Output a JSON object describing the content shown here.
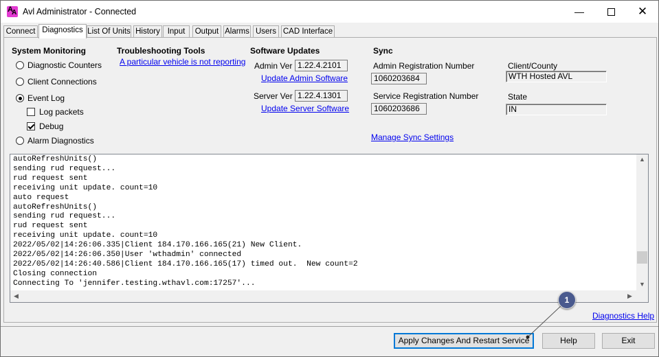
{
  "window": {
    "title": "Avl Administrator - Connected",
    "minimize_glyph": "—",
    "close_glyph": "✕"
  },
  "tabs": [
    {
      "label": "Connect"
    },
    {
      "label": "Diagnostics"
    },
    {
      "label": "List Of Units"
    },
    {
      "label": "History"
    },
    {
      "label": "Input"
    },
    {
      "label": "Output"
    },
    {
      "label": "Alarms"
    },
    {
      "label": "Users"
    },
    {
      "label": "CAD Interface"
    }
  ],
  "system_monitoring": {
    "header": "System Monitoring",
    "options": [
      {
        "label": "Diagnostic Counters",
        "selected": false
      },
      {
        "label": "Client Connections",
        "selected": false
      },
      {
        "label": "Event Log",
        "selected": true
      },
      {
        "label": "Alarm Diagnostics",
        "selected": false
      }
    ],
    "log_packets": {
      "label": "Log packets",
      "checked": false
    },
    "debug": {
      "label": "Debug",
      "checked": true
    }
  },
  "troubleshooting": {
    "header": "Troubleshooting Tools",
    "link": "A particular vehicle is not reporting"
  },
  "software_updates": {
    "header": "Software Updates",
    "admin_ver_label": "Admin Ver",
    "admin_ver_value": "1.22.4.2101",
    "update_admin_link": "Update Admin Software",
    "server_ver_label": "Server Ver",
    "server_ver_value": "1.22.4.1301",
    "update_server_link": "Update Server Software"
  },
  "sync": {
    "header": "Sync",
    "admin_reg_label": "Admin Registration Number",
    "admin_reg_value": "1060203684",
    "service_reg_label": "Service Registration Number",
    "service_reg_value": "1060203686",
    "manage_link": "Manage Sync Settings",
    "client_county_label": "Client/County",
    "client_county_value": "WTH Hosted AVL",
    "state_label": "State",
    "state_value": "IN"
  },
  "log": {
    "lines": [
      "autoRefreshUnits()",
      "sending rud request...",
      "rud request sent",
      "receiving unit update. count=10",
      "auto request",
      "autoRefreshUnits()",
      "sending rud request...",
      "rud request sent",
      "receiving unit update. count=10",
      "2022/05/02|14:26:06.335|Client 184.170.166.165(21) New Client.",
      "2022/05/02|14:26:06.350|User 'wthadmin' connected",
      "2022/05/02|14:26:40.586|Client 184.170.166.165(17) timed out.  New count=2",
      "Closing connection",
      "Connecting To 'jennifer.testing.wthavl.com:17257'..."
    ],
    "scroll_position": 0.85
  },
  "footer": {
    "help_link": "Diagnostics Help",
    "apply_button": "Apply Changes And Restart Service",
    "help_button": "Help",
    "exit_button": "Exit"
  },
  "callout": {
    "number": "1"
  },
  "colors": {
    "link": "#0000ee",
    "primary_border": "#0078d7",
    "badge": "#4a5a8e",
    "app_icon": "#e23ad1"
  }
}
